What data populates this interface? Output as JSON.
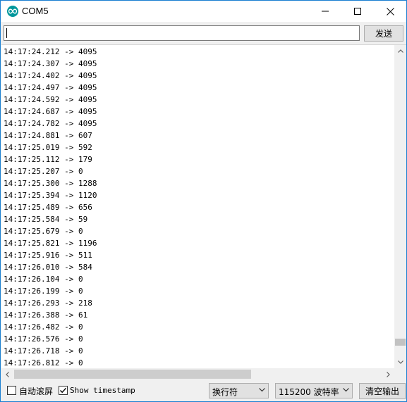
{
  "window": {
    "title": "COM5",
    "icon": "arduino-infinity-icon"
  },
  "send_row": {
    "input_value": "",
    "send_label": "发送"
  },
  "output": {
    "lines": [
      "14:17:24.212 -> 4095",
      "14:17:24.307 -> 4095",
      "14:17:24.402 -> 4095",
      "14:17:24.497 -> 4095",
      "14:17:24.592 -> 4095",
      "14:17:24.687 -> 4095",
      "14:17:24.782 -> 4095",
      "14:17:24.881 -> 607",
      "14:17:25.019 -> 592",
      "14:17:25.112 -> 179",
      "14:17:25.207 -> 0",
      "14:17:25.300 -> 1288",
      "14:17:25.394 -> 1120",
      "14:17:25.489 -> 656",
      "14:17:25.584 -> 59",
      "14:17:25.679 -> 0",
      "14:17:25.821 -> 1196",
      "14:17:25.916 -> 511",
      "14:17:26.010 -> 584",
      "14:17:26.104 -> 0",
      "14:17:26.199 -> 0",
      "14:17:26.293 -> 218",
      "14:17:26.388 -> 61",
      "14:17:26.482 -> 0",
      "14:17:26.576 -> 0",
      "14:17:26.718 -> 0",
      "14:17:26.812 -> 0"
    ]
  },
  "bottom_bar": {
    "autoscroll_label": "自动滚屏",
    "autoscroll_checked": false,
    "timestamp_label": "Show timestamp",
    "timestamp_checked": true,
    "line_ending_value": "换行符",
    "baud_value": "115200 波特率",
    "clear_label": "清空输出"
  },
  "colors": {
    "window_border": "#1a7fd1",
    "arduino_teal": "#00979c"
  }
}
